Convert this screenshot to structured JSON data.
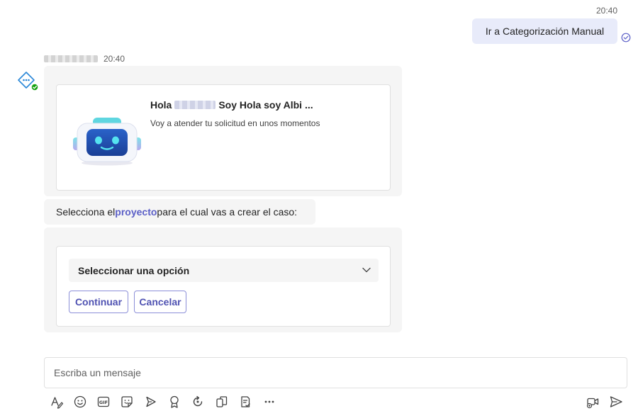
{
  "outgoing": {
    "time": "20:40",
    "message": "Ir a Categorización Manual",
    "status_icon": "read-check-icon"
  },
  "bot": {
    "avatar_icon": "bot-avatar-icon",
    "time": "20:40",
    "hero": {
      "greeting": "Hola",
      "title_rest": "Soy Hola soy Albi ...",
      "subtitle": "Voy a atender tu solicitud en unos momentos",
      "image_icon": "robot-image"
    },
    "prompt": {
      "before": "Selecciona el ",
      "highlight": "proyecto",
      "after": " para el cual vas a crear el caso:"
    },
    "form": {
      "select_value": "Seleccionar una opción",
      "continue_label": "Continuar",
      "cancel_label": "Cancelar"
    }
  },
  "composer": {
    "placeholder": "Escriba un mensaje",
    "tools": [
      "format-icon",
      "emoji-icon",
      "gif-icon",
      "sticker-icon",
      "schedule-meeting-icon",
      "praise-icon",
      "loop-icon",
      "attach-icon",
      "approvals-icon",
      "more-icon"
    ],
    "right_tools": [
      "meet-now-icon",
      "send-icon"
    ]
  },
  "colors": {
    "accent": "#5b5fc7",
    "sent_bubble": "#e8ebfa",
    "bot_bubble": "#f5f5f5",
    "online": "#13a10e"
  }
}
